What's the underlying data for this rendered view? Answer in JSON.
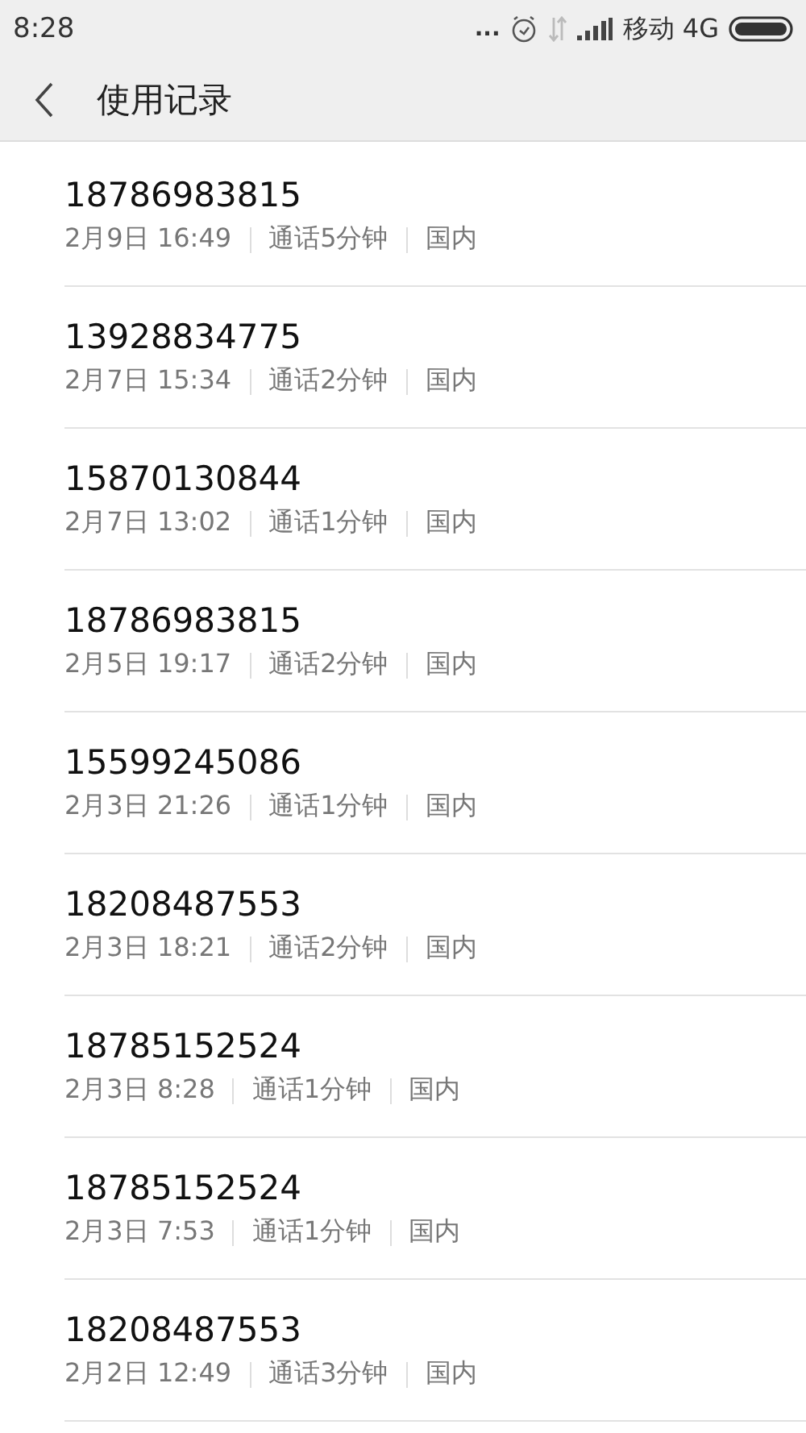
{
  "status_bar": {
    "time": "8:28",
    "more": "...",
    "carrier": "移动 4G"
  },
  "header": {
    "title": "使用记录"
  },
  "records": [
    {
      "number": "18786983815",
      "datetime": "2月9日 16:49",
      "duration": "通话5分钟",
      "region": "国内"
    },
    {
      "number": "13928834775",
      "datetime": "2月7日 15:34",
      "duration": "通话2分钟",
      "region": "国内"
    },
    {
      "number": "15870130844",
      "datetime": "2月7日 13:02",
      "duration": "通话1分钟",
      "region": "国内"
    },
    {
      "number": "18786983815",
      "datetime": "2月5日 19:17",
      "duration": "通话2分钟",
      "region": "国内"
    },
    {
      "number": "15599245086",
      "datetime": "2月3日 21:26",
      "duration": "通话1分钟",
      "region": "国内"
    },
    {
      "number": "18208487553",
      "datetime": "2月3日 18:21",
      "duration": "通话2分钟",
      "region": "国内"
    },
    {
      "number": "18785152524",
      "datetime": "2月3日 8:28",
      "duration": "通话1分钟",
      "region": "国内"
    },
    {
      "number": "18785152524",
      "datetime": "2月3日 7:53",
      "duration": "通话1分钟",
      "region": "国内"
    },
    {
      "number": "18208487553",
      "datetime": "2月2日 12:49",
      "duration": "通话3分钟",
      "region": "国内"
    }
  ]
}
